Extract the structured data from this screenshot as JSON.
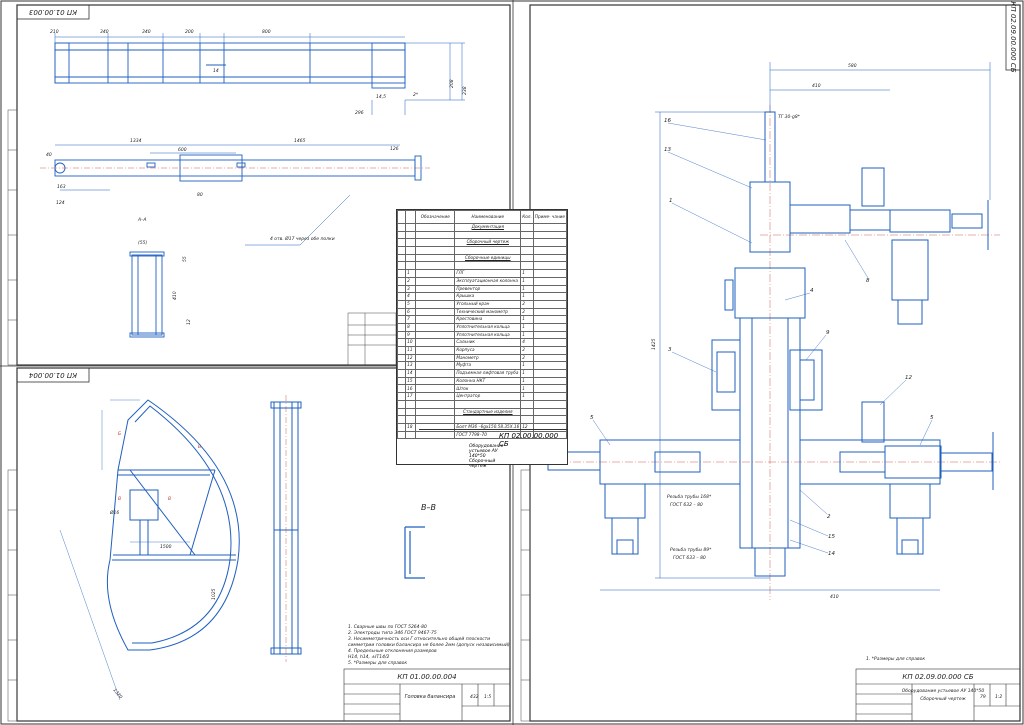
{
  "top_left_sheet": {
    "rotated_code": "КП 01.00.003",
    "dims_top": [
      "210",
      "340",
      "340",
      "200",
      "800"
    ],
    "dims_side": [
      "14",
      "14,5",
      "2*",
      "208",
      "296",
      "238"
    ],
    "dims_plan": [
      "40",
      "1334",
      "600",
      "1465",
      "163",
      "124",
      "80",
      "126"
    ],
    "section_label": "А–А",
    "section_dims": [
      "(55)",
      "55",
      "410",
      "12"
    ],
    "note": "4 отв. Ø17 через обе полки"
  },
  "bottom_left_sheet": {
    "rotated_code": "КП 01.00.004",
    "labels": [
      "Б",
      "Б",
      "В",
      "В",
      "Ø16",
      "1025",
      "1500",
      "1320"
    ],
    "section_label": "В–В",
    "notes": [
      "1. Сварные швы по ГОСТ 5264-80",
      "2. Электроды типа Э46 ГОСТ 9467-75",
      "3. Несимметричность оси Г относительно общей плоскости",
      "   симметрии головки балансира не более 2мм (допуск независимый)",
      "4. Предельные отклонения размеров",
      "   Н14, h14, ±IT14/2",
      "5. *Размеры для справок"
    ],
    "stamp_code": "КП 01.00.00.004",
    "stamp_name": "Головка балансира",
    "stamp_mass": "432",
    "stamp_scale": "1:5"
  },
  "right_sheet": {
    "rotated_code": "КП 02.09.00.000 СБ",
    "dims": [
      "580",
      "410",
      "1425",
      "410",
      "ТГ 30-g8*"
    ],
    "callouts": [
      "16",
      "13",
      "1",
      "8",
      "4",
      "9",
      "3",
      "12",
      "5",
      "5",
      "2",
      "15",
      "14"
    ],
    "thread_notes": [
      "Резьба трубы 168*",
      "ГОСТ 632 – 80",
      "Резьба трубы 89*",
      "ГОСТ 633 – 80"
    ],
    "note": "1. *Размеры для справок",
    "stamp_code": "КП 02.09.00.000 СБ",
    "stamp_name": "Оборудование устьевое АУ 140*50",
    "stamp_sub": "Сборочный чертеж",
    "stamp_mass": "79",
    "stamp_scale": "1:2"
  },
  "spec_table": {
    "headers": [
      "Обозначение",
      "Наименование",
      "Кол.",
      "Приме- чание"
    ],
    "sections": [
      "Документация",
      "Сборочный чертеж",
      "Сборочные единицы",
      "Стандартные изделия"
    ],
    "rows": [
      {
        "pos": "1",
        "name": "ГЛГ",
        "qty": "1"
      },
      {
        "pos": "2",
        "name": "Эксплуатационная колонна",
        "qty": "1"
      },
      {
        "pos": "3",
        "name": "Превентор",
        "qty": "1"
      },
      {
        "pos": "4",
        "name": "Крышка",
        "qty": "1"
      },
      {
        "pos": "5",
        "name": "Угольный кран",
        "qty": "2"
      },
      {
        "pos": "6",
        "name": "Технический манометр",
        "qty": "2"
      },
      {
        "pos": "7",
        "name": "Крестовина",
        "qty": "1"
      },
      {
        "pos": "8",
        "name": "Уплотнительная кольца",
        "qty": "1"
      },
      {
        "pos": "9",
        "name": "Уплотнительная кольца",
        "qty": "1"
      },
      {
        "pos": "10",
        "name": "Сальник",
        "qty": "4"
      },
      {
        "pos": "11",
        "name": "Корпуса",
        "qty": "2"
      },
      {
        "pos": "12",
        "name": "Манометр",
        "qty": "2"
      },
      {
        "pos": "13",
        "name": "Муфта",
        "qty": "1"
      },
      {
        "pos": "14",
        "name": "Подъемная лифтовая труба",
        "qty": "1"
      },
      {
        "pos": "15",
        "name": "Колонна НКТ",
        "qty": "1"
      },
      {
        "pos": "16",
        "name": "Шток",
        "qty": "1"
      },
      {
        "pos": "17",
        "name": "Центратор",
        "qty": "1"
      }
    ],
    "standard_rows": [
      {
        "pos": "18",
        "name": "Болт М36 –6gx150.58.35Х.16",
        "qty": "12"
      },
      {
        "pos": "",
        "name": "ГОСТ 7798–70",
        "qty": ""
      }
    ],
    "stamp_code": "КП 02.00.00.000 СБ",
    "stamp_name": "Оборудование устьевое АУ 140*50 Сборочный чертеж"
  },
  "colors": {
    "line": "#1f5fbf",
    "ink": "#222222",
    "axis": "#c0392b",
    "frame": "#333333"
  }
}
